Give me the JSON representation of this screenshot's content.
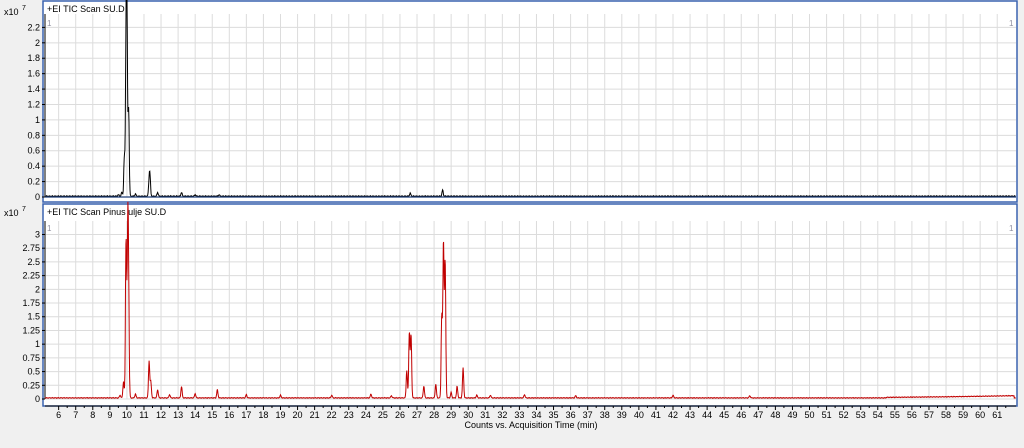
{
  "window": {
    "background": "#f0f0f0"
  },
  "x_axis": {
    "title": "Counts vs. Acquisition Time (min)",
    "min": 5.2,
    "max": 62.1,
    "ticks": [
      6,
      7,
      8,
      9,
      10,
      11,
      12,
      13,
      14,
      15,
      16,
      17,
      18,
      19,
      20,
      21,
      22,
      23,
      24,
      25,
      26,
      27,
      28,
      29,
      30,
      31,
      32,
      33,
      34,
      35,
      36,
      37,
      38,
      39,
      40,
      41,
      42,
      43,
      44,
      45,
      46,
      47,
      48,
      49,
      50,
      51,
      52,
      53,
      54,
      55,
      56,
      57,
      58,
      59,
      60,
      61
    ]
  },
  "panels": [
    {
      "title": "+EI TIC Scan SU.D",
      "scale_label": "x10",
      "scale_exp": "7",
      "cursor_left": "1",
      "cursor_right": "1",
      "color": "#000000",
      "ylim": [
        0,
        2.27
      ],
      "yticks": [
        "0",
        "0.2",
        "0.4",
        "0.6",
        "0.8",
        "1",
        "1.2",
        "1.4",
        "1.6",
        "1.8",
        "2",
        "2.2"
      ],
      "ytick_values": [
        0,
        0.2,
        0.4,
        0.6,
        0.8,
        1,
        1.2,
        1.4,
        1.6,
        1.8,
        2,
        2.2
      ]
    },
    {
      "title": "+EI TIC Scan Pinus ulje SU.D",
      "scale_label": "x10",
      "scale_exp": "7",
      "cursor_left": "1",
      "cursor_right": "1",
      "color": "#c00000",
      "ylim": [
        0,
        3.1
      ],
      "yticks": [
        "0",
        "0.25",
        "0.5",
        "0.75",
        "1",
        "1.25",
        "1.5",
        "1.75",
        "2",
        "2.25",
        "2.5",
        "2.75",
        "3"
      ],
      "ytick_values": [
        0,
        0.25,
        0.5,
        0.75,
        1,
        1.25,
        1.5,
        1.75,
        2,
        2.25,
        2.5,
        2.75,
        3
      ]
    }
  ],
  "chart_data": [
    {
      "type": "line",
      "title": "+EI TIC Scan SU.D",
      "xlabel": "Counts vs. Acquisition Time (min)",
      "ylabel": "x10^7",
      "xlim": [
        5.2,
        62.1
      ],
      "ylim": [
        0,
        2.27
      ],
      "baseline": 0.01,
      "grid": true,
      "peaks": [
        {
          "x": 9.5,
          "y": 0.02
        },
        {
          "x": 9.7,
          "y": 0.05
        },
        {
          "x": 9.85,
          "y": 0.5
        },
        {
          "x": 9.95,
          "y": 1.7
        },
        {
          "x": 10.0,
          "y": 2.07
        },
        {
          "x": 10.1,
          "y": 1.12
        },
        {
          "x": 10.5,
          "y": 0.03
        },
        {
          "x": 11.3,
          "y": 0.18
        },
        {
          "x": 11.35,
          "y": 0.24
        },
        {
          "x": 11.8,
          "y": 0.05
        },
        {
          "x": 13.2,
          "y": 0.05
        },
        {
          "x": 14.0,
          "y": 0.02
        },
        {
          "x": 15.4,
          "y": 0.02
        },
        {
          "x": 26.6,
          "y": 0.04
        },
        {
          "x": 28.5,
          "y": 0.08
        }
      ]
    },
    {
      "type": "line",
      "title": "+EI TIC Scan Pinus ulje SU.D",
      "xlabel": "Counts vs. Acquisition Time (min)",
      "ylabel": "x10^7",
      "xlim": [
        5.2,
        62.1
      ],
      "ylim": [
        0,
        3.1
      ],
      "baseline": 0.02,
      "grid": true,
      "peaks": [
        {
          "x": 9.6,
          "y": 0.05
        },
        {
          "x": 9.8,
          "y": 0.3
        },
        {
          "x": 9.95,
          "y": 2.9
        },
        {
          "x": 10.05,
          "y": 2.85
        },
        {
          "x": 10.1,
          "y": 1.55
        },
        {
          "x": 10.5,
          "y": 0.07
        },
        {
          "x": 11.3,
          "y": 0.68
        },
        {
          "x": 11.4,
          "y": 0.3
        },
        {
          "x": 11.8,
          "y": 0.15
        },
        {
          "x": 12.5,
          "y": 0.06
        },
        {
          "x": 13.2,
          "y": 0.21
        },
        {
          "x": 14.0,
          "y": 0.08
        },
        {
          "x": 15.3,
          "y": 0.15
        },
        {
          "x": 17.0,
          "y": 0.06
        },
        {
          "x": 19.0,
          "y": 0.05
        },
        {
          "x": 22.0,
          "y": 0.05
        },
        {
          "x": 24.3,
          "y": 0.07
        },
        {
          "x": 25.5,
          "y": 0.04
        },
        {
          "x": 26.4,
          "y": 0.5
        },
        {
          "x": 26.55,
          "y": 1.2
        },
        {
          "x": 26.65,
          "y": 1.15
        },
        {
          "x": 27.4,
          "y": 0.22
        },
        {
          "x": 28.1,
          "y": 0.25
        },
        {
          "x": 28.45,
          "y": 1.5
        },
        {
          "x": 28.55,
          "y": 2.85
        },
        {
          "x": 28.65,
          "y": 2.5
        },
        {
          "x": 29.0,
          "y": 0.1
        },
        {
          "x": 29.35,
          "y": 0.21
        },
        {
          "x": 29.7,
          "y": 0.55
        },
        {
          "x": 30.5,
          "y": 0.05
        },
        {
          "x": 31.3,
          "y": 0.05
        },
        {
          "x": 33.3,
          "y": 0.06
        },
        {
          "x": 36.3,
          "y": 0.04
        },
        {
          "x": 42.0,
          "y": 0.05
        },
        {
          "x": 46.5,
          "y": 0.04
        }
      ],
      "tail": [
        {
          "x": 54.5,
          "y": 0.03
        },
        {
          "x": 58.0,
          "y": 0.04
        },
        {
          "x": 60.0,
          "y": 0.05
        },
        {
          "x": 62.0,
          "y": 0.06
        }
      ]
    }
  ]
}
